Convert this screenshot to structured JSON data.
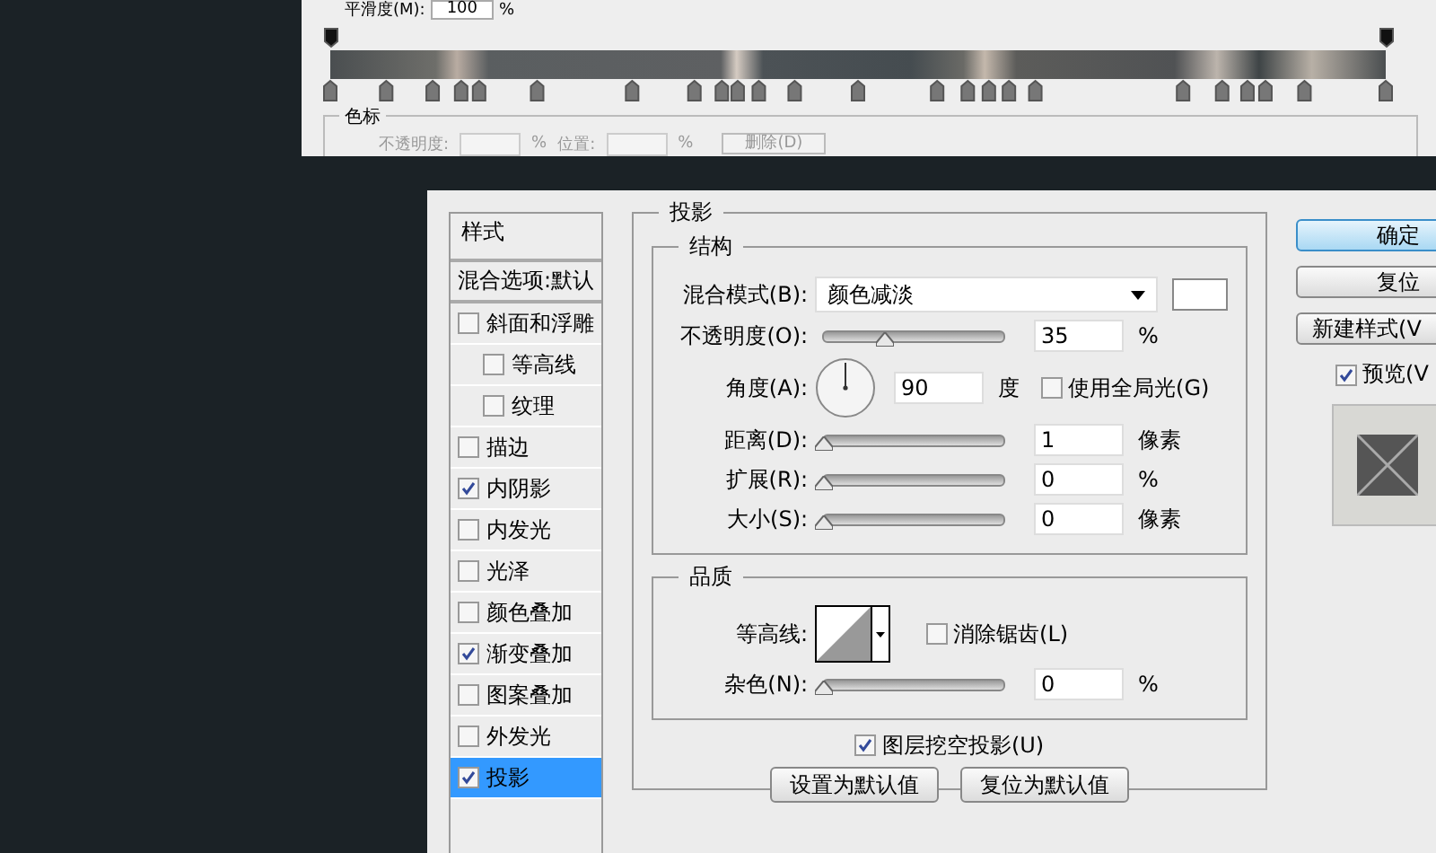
{
  "gradient_editor": {
    "smoothness": {
      "label": "平滑度(M):",
      "value": "100",
      "unit": "%"
    },
    "color_stop_group": {
      "title": "色标",
      "opacity": {
        "label": "不透明度:",
        "unit": "%"
      },
      "location": {
        "label": "位置:",
        "unit": "%"
      },
      "delete_button": "删除(D)"
    }
  },
  "styles_panel": {
    "title": "样式",
    "blend_options": "混合选项:默认",
    "items": [
      {
        "label": "斜面和浮雕",
        "checked": false,
        "selected": false,
        "children": [
          {
            "label": "等高线",
            "checked": false,
            "selected": false
          },
          {
            "label": "纹理",
            "checked": false,
            "selected": false
          }
        ]
      },
      {
        "label": "描边",
        "checked": false,
        "selected": false
      },
      {
        "label": "内阴影",
        "checked": true,
        "selected": false
      },
      {
        "label": "内发光",
        "checked": false,
        "selected": false
      },
      {
        "label": "光泽",
        "checked": false,
        "selected": false
      },
      {
        "label": "颜色叠加",
        "checked": false,
        "selected": false
      },
      {
        "label": "渐变叠加",
        "checked": true,
        "selected": false
      },
      {
        "label": "图案叠加",
        "checked": false,
        "selected": false
      },
      {
        "label": "外发光",
        "checked": false,
        "selected": false
      },
      {
        "label": "投影",
        "checked": true,
        "selected": true
      }
    ]
  },
  "drop_shadow": {
    "title": "投影",
    "structure": {
      "title": "结构",
      "blend_mode": {
        "label": "混合模式(B):",
        "value": "颜色减淡"
      },
      "opacity": {
        "label": "不透明度(O):",
        "level": 0.34,
        "value": "35",
        "unit": "%"
      },
      "angle": {
        "label": "角度(A):",
        "value": "90",
        "unit": "度"
      },
      "global_light": {
        "label": "使用全局光(G)",
        "checked": false
      },
      "distance": {
        "label": "距离(D):",
        "level": 0,
        "value": "1",
        "unit": "像素"
      },
      "spread": {
        "label": "扩展(R):",
        "level": 0,
        "value": "0",
        "unit": "%"
      },
      "size": {
        "label": "大小(S):",
        "level": 0,
        "value": "0",
        "unit": "像素"
      }
    },
    "quality": {
      "title": "品质",
      "contour": {
        "label": "等高线:"
      },
      "anti_aliased": {
        "label": "消除锯齿(L)",
        "checked": false
      },
      "noise": {
        "label": "杂色(N):",
        "level": 0,
        "value": "0",
        "unit": "%"
      }
    },
    "knockout": {
      "label": "图层挖空投影(U)",
      "checked": true
    },
    "buttons": [
      "设置为默认值",
      "复位为默认值"
    ]
  },
  "actions": {
    "buttons": [
      {
        "label": "确定",
        "primary": true
      },
      {
        "label": "复位",
        "primary": false
      },
      {
        "label": "新建样式(V",
        "primary": false
      }
    ],
    "preview": {
      "label": "预览(V",
      "checked": true
    }
  }
}
